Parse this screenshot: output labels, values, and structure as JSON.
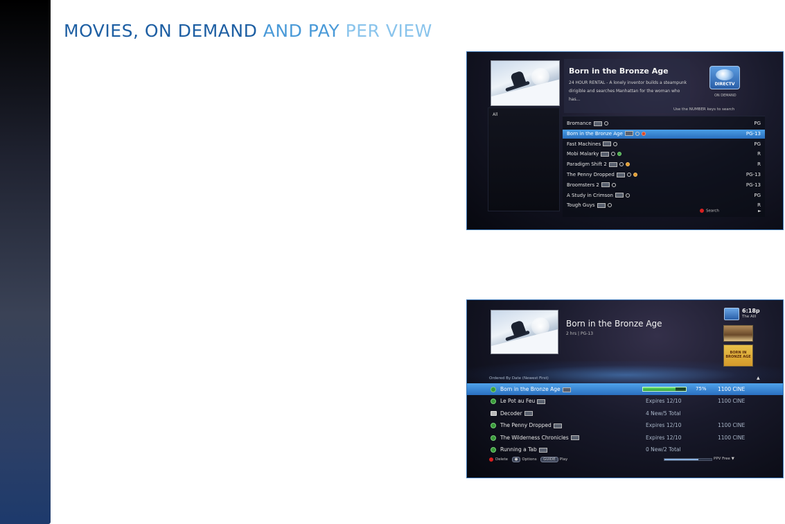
{
  "page": {
    "title_part1": "MOVIES, ON DEMAND",
    "title_part2": " AND PAY",
    "title_part3": " PER VIEW"
  },
  "colors": {
    "title_dark_blue": "#1e5fa3",
    "title_mid_blue": "#4a9ad8",
    "title_light_blue": "#8ac4ec",
    "selection_blue": "#2a6fbe",
    "frame_border": "#3d78b8"
  },
  "screen1": {
    "left_panel_label": "All",
    "title": "Born in the Bronze Age",
    "description": "24 HOUR RENTAL - A lonely inventor builds a steampunk dirigible and searches Manhattan for the woman who has...",
    "hint": "Use the NUMBER keys to search",
    "logo_text": "DIRECTV",
    "logo_caption": "ON DEMAND",
    "list": [
      {
        "name": "Bromance",
        "rating": "PG",
        "icons": [
          "hd",
          "dot"
        ]
      },
      {
        "name": "Born in the Bronze Age",
        "rating": "PG-13",
        "icons": [
          "hd",
          "dot",
          "dot-r"
        ],
        "selected": true
      },
      {
        "name": "Fast Machines",
        "rating": "PG",
        "icons": [
          "hd",
          "dot"
        ]
      },
      {
        "name": "Mobi Malarky",
        "rating": "R",
        "icons": [
          "hd",
          "dot",
          "dot-g"
        ]
      },
      {
        "name": "Paradigm Shift 2",
        "rating": "R",
        "icons": [
          "hd",
          "dot",
          "dot-o"
        ]
      },
      {
        "name": "The Penny Dropped",
        "rating": "PG-13",
        "icons": [
          "hd",
          "dot",
          "dot-o"
        ]
      },
      {
        "name": "Broomsters 2",
        "rating": "PG-13",
        "icons": [
          "hd",
          "dot"
        ]
      },
      {
        "name": "A Study in Crimson",
        "rating": "PG",
        "icons": [
          "hd",
          "dot"
        ]
      },
      {
        "name": "Tough Guys",
        "rating": "R",
        "icons": [
          "hd",
          "dot"
        ]
      }
    ],
    "search_label": "Search",
    "more_arrow": "►"
  },
  "screen2": {
    "title": "Born in the Bronze Age",
    "subtitle": "2 hrs | PG-13",
    "time": "6:18p",
    "channel": "The Alll",
    "poster_text": "BORN IN BRONZE AGE",
    "list_header": "Ordered By Date (Newest First)",
    "list_header_more": "▲",
    "rows": [
      {
        "name": "Born in the Bronze Age",
        "status": "",
        "progress_percent": 75,
        "progress_label": "75%",
        "channel": "1100 CINE",
        "icon": "dot",
        "selected": true
      },
      {
        "name": "Le Pot au Feu",
        "status": "Expires 12/10",
        "channel": "1100 CINE",
        "icon": "dot"
      },
      {
        "name": "Decoder",
        "status": "4 New/5 Total",
        "channel": "",
        "icon": "tv"
      },
      {
        "name": "The Penny Dropped",
        "status": "Expires 12/10",
        "channel": "1100 CINE",
        "icon": "dot"
      },
      {
        "name": "The Wilderness Chronicles",
        "status": "Expires 12/10",
        "channel": "1100 CINE",
        "icon": "dot"
      },
      {
        "name": "Running a Tab",
        "status": "0 New/2 Total",
        "channel": "",
        "icon": "dot"
      }
    ],
    "footer": {
      "delete": "Delete",
      "options": "Options",
      "play_key": "GUIDE",
      "play": "Play",
      "filter": "PPV Free ▼"
    },
    "scroll_position": 0.72
  }
}
